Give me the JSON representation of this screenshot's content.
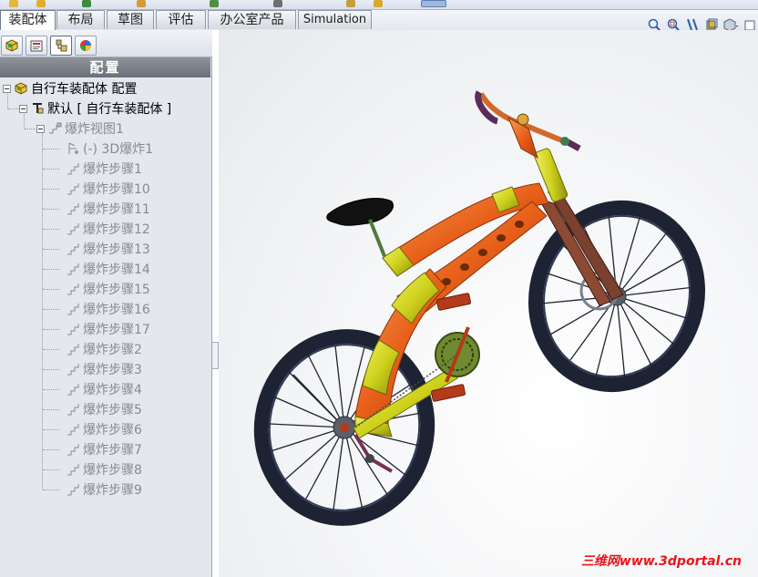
{
  "command_tabs": [
    {
      "id": "assembly",
      "label": "装配体",
      "active": true
    },
    {
      "id": "layout",
      "label": "布局"
    },
    {
      "id": "sketch",
      "label": "草图"
    },
    {
      "id": "evaluate",
      "label": "评估"
    },
    {
      "id": "office",
      "label": "办公室产品"
    },
    {
      "id": "simulation",
      "label": "Simulation"
    }
  ],
  "left_pane": {
    "title": "配置",
    "tabs": [
      "feature-manager-icon",
      "property-manager-icon",
      "configuration-manager-icon",
      "display-manager-icon"
    ],
    "tree": {
      "root": "自行车装配体 配置",
      "config": "默认 [ 自行车装配体 ]",
      "explode_view": "爆炸视图1",
      "explode_3d": "(-) 3D爆炸1",
      "steps": [
        "爆炸步骤1",
        "爆炸步骤10",
        "爆炸步骤11",
        "爆炸步骤12",
        "爆炸步骤13",
        "爆炸步骤14",
        "爆炸步骤15",
        "爆炸步骤16",
        "爆炸步骤17",
        "爆炸步骤2",
        "爆炸步骤3",
        "爆炸步骤4",
        "爆炸步骤5",
        "爆炸步骤6",
        "爆炸步骤7",
        "爆炸步骤8",
        "爆炸步骤9"
      ]
    }
  },
  "heads_up_toolbar": [
    "zoom-to-fit-icon",
    "zoom-to-area-icon",
    "section-view-icon",
    "view-orientation-icon",
    "display-style-icon",
    "hide-show-items-icon"
  ],
  "watermark": "三维网www.3dportal.cn",
  "colors": {
    "frame_orange": "#e8601a",
    "frame_yellow": "#cfd21c",
    "tire": "#1e2333",
    "watermark": "#e8141c"
  }
}
